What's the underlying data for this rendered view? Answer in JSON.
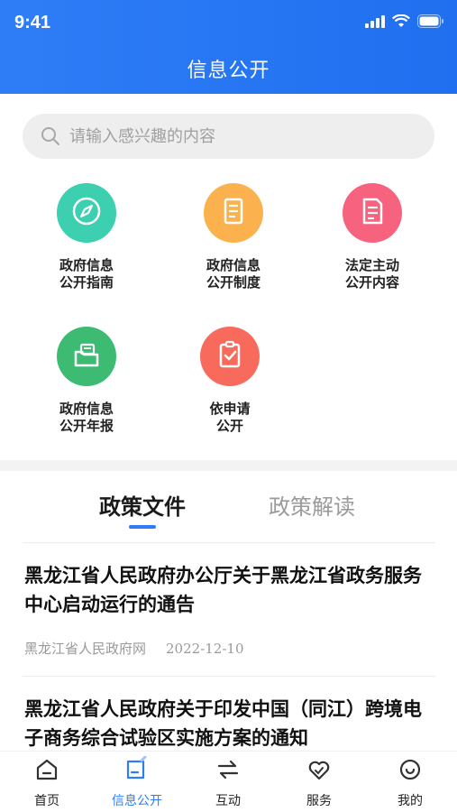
{
  "status_bar": {
    "time": "9:41"
  },
  "header": {
    "title": "信息公开"
  },
  "search": {
    "placeholder": "请输入感兴趣的内容"
  },
  "grid": [
    {
      "line1": "政府信息",
      "line2": "公开指南",
      "icon": "compass-icon",
      "color": "#3ccfb0"
    },
    {
      "line1": "政府信息",
      "line2": "公开制度",
      "icon": "document-icon",
      "color": "#fbb24e"
    },
    {
      "line1": "法定主动",
      "line2": "公开内容",
      "icon": "file-icon",
      "color": "#f7637e"
    },
    {
      "line1": "政府信息",
      "line2": "公开年报",
      "icon": "folder-icon",
      "color": "#3dbb72"
    },
    {
      "line1": "依申请",
      "line2": "公开",
      "icon": "clipboard-check-icon",
      "color": "#f86b5c"
    }
  ],
  "tabs": {
    "active": "政策文件",
    "inactive": "政策解读"
  },
  "articles": [
    {
      "title_line1": "黑龙江省人民政府办公厅关于黑龙江省政务服务",
      "title_line2": "中心启动运行的通告",
      "source": "黑龙江省人民政府网",
      "date": "2022-12-10"
    },
    {
      "title_line1": "黑龙江省人民政府关于印发中国（同江）跨境电",
      "title_line2": "子商务综合试验区实施方案的通知"
    }
  ],
  "tabbar": [
    {
      "label": "首页",
      "icon": "home-icon"
    },
    {
      "label": "信息公开",
      "icon": "info-disclosure-icon",
      "active": true
    },
    {
      "label": "互动",
      "icon": "interaction-icon"
    },
    {
      "label": "服务",
      "icon": "heart-service-icon"
    },
    {
      "label": "我的",
      "icon": "profile-icon"
    }
  ],
  "colors": {
    "primary": "#2f7df6"
  }
}
